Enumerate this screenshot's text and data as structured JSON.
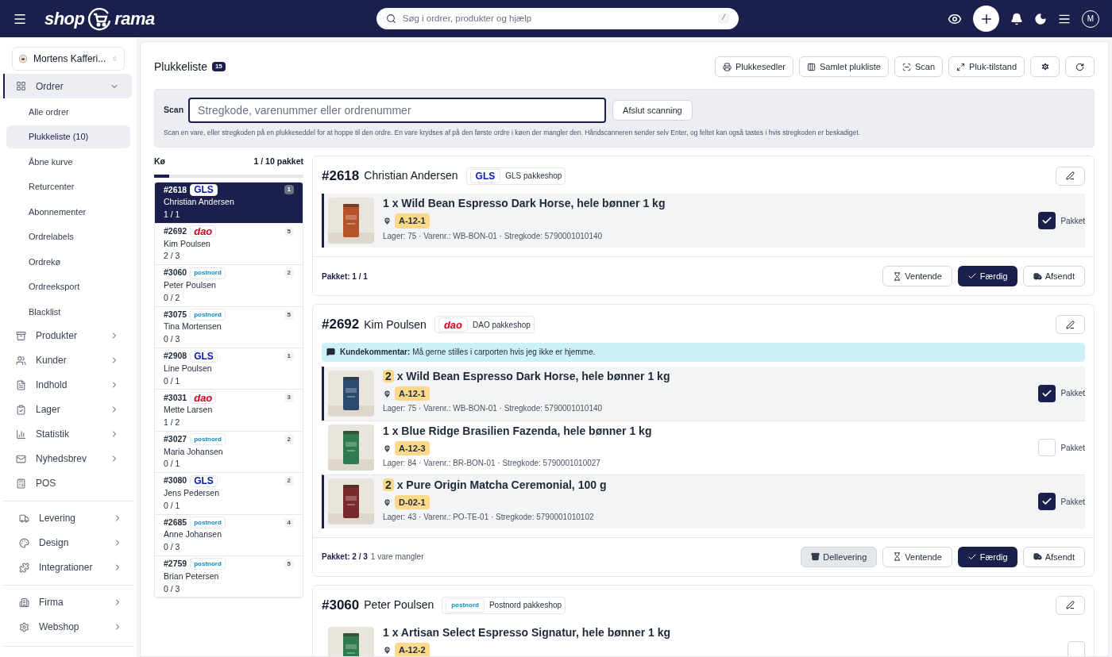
{
  "topbar": {
    "logo_left": "shop",
    "logo_right": "rama",
    "search": {
      "placeholder": "Søg i ordrer, produkter og hjælp",
      "shortcut": "/"
    },
    "avatar": "M"
  },
  "sidebar": {
    "store": "Mortens Kafferi...",
    "sections": [
      [
        {
          "label": "Ordrer",
          "expanded": true,
          "children": [
            {
              "label": "Alle ordrer",
              "selected": false
            },
            {
              "label": "Plukkeliste (10)",
              "selected": true
            },
            {
              "label": "Åbne kurve",
              "selected": false
            },
            {
              "label": "Returcenter",
              "selected": false
            },
            {
              "label": "Abonnementer",
              "selected": false
            },
            {
              "label": "Ordrelabels",
              "selected": false
            },
            {
              "label": "Ordrekø",
              "selected": false
            },
            {
              "label": "Ordreeksport",
              "selected": false
            },
            {
              "label": "Blacklist",
              "selected": false
            }
          ]
        },
        {
          "label": "Produkter",
          "expanded": false
        },
        {
          "label": "Kunder",
          "expanded": false
        },
        {
          "label": "Indhold",
          "expanded": false
        },
        {
          "label": "Lager",
          "expanded": false
        },
        {
          "label": "Statistik",
          "expanded": false
        },
        {
          "label": "Nyhedsbrev",
          "expanded": false
        },
        {
          "label": "POS"
        }
      ],
      [
        {
          "label": "Levering",
          "expanded": false
        },
        {
          "label": "Design",
          "expanded": false
        },
        {
          "label": "Integrationer",
          "expanded": false
        }
      ],
      [
        {
          "label": "Firma",
          "expanded": false
        },
        {
          "label": "Webshop",
          "expanded": false
        }
      ]
    ]
  },
  "page": {
    "title": "Plukkeliste",
    "count": "15",
    "actions": [
      "Plukkesedler",
      "Samlet plukliste",
      "Scan",
      "Pluk-tilstand"
    ]
  },
  "scan": {
    "label": "Scan",
    "placeholder": "Stregkode, varenummer eller ordrenummer",
    "button": "Afslut scanning",
    "help": "Scan en vare, eller stregkoden på en plukkeseddel for at hoppe til den ordre. En vare krydses af på den første ordre i køen der mangler den. Håndscanneren sender selv Enter, og feltet kan også tastes i hvis stregkoden er beskadiget."
  },
  "queue": {
    "title": "Kø",
    "summary": "1 / 10 pakket",
    "level": 0.1,
    "items": [
      {
        "number": "#2618",
        "kind": "gls",
        "logo": "GLS",
        "name": "Christian Andersen",
        "progress": "1 / 1",
        "count": "1",
        "selected": true
      },
      {
        "number": "#2692",
        "kind": "dao",
        "logo": "dao",
        "name": "Kim Poulsen",
        "progress": "2 / 3",
        "count": "5",
        "selected": false
      },
      {
        "number": "#3060",
        "kind": "postnord",
        "logo": "postnord",
        "name": "Peter Poulsen",
        "progress": "0 / 2",
        "count": "2",
        "selected": false
      },
      {
        "number": "#3075",
        "kind": "postnord",
        "logo": "postnord",
        "name": "Tina Mortensen",
        "progress": "0 / 3",
        "count": "5",
        "selected": false
      },
      {
        "number": "#2908",
        "kind": "gls",
        "logo": "GLS",
        "name": "Line Poulsen",
        "progress": "0 / 1",
        "count": "1",
        "selected": false
      },
      {
        "number": "#3031",
        "kind": "dao",
        "logo": "dao",
        "name": "Mette Larsen",
        "progress": "1 / 2",
        "count": "3",
        "selected": false
      },
      {
        "number": "#3027",
        "kind": "postnord",
        "logo": "postnord",
        "name": "Maria Johansen",
        "progress": "0 / 1",
        "count": "2",
        "selected": false
      },
      {
        "number": "#3080",
        "kind": "gls",
        "logo": "GLS",
        "name": "Jens Pedersen",
        "progress": "0 / 1",
        "count": "2",
        "selected": false
      },
      {
        "number": "#2685",
        "kind": "postnord",
        "logo": "postnord",
        "name": "Anne Johansen",
        "progress": "0 / 3",
        "count": "4",
        "selected": false
      },
      {
        "number": "#2759",
        "kind": "postnord",
        "logo": "postnord",
        "name": "Brian Petersen",
        "progress": "0 / 3",
        "count": "5",
        "selected": false
      }
    ]
  },
  "orders": [
    {
      "number": "#2618",
      "name": "Christian Andersen",
      "kind": "gls",
      "logo": "GLS",
      "shipping": "GLS pakkeshop",
      "items": [
        {
          "qty": "1",
          "highlight": false,
          "title": "x Wild Bean Espresso Dark Horse, hele bønner 1 kg",
          "location": "A-12-1",
          "info": "Lager: 75 · Varenr.: WB-BON-01 · Stregkode: 5790001010140",
          "checkbox": "Pakket",
          "packed": true
        }
      ],
      "packed_label": "Pakket: 1 / 1",
      "buttons": [
        {
          "label": "Ventende",
          "kind": "hourglass"
        },
        {
          "label": "Færdig",
          "kind": "done"
        },
        {
          "label": "Afsendt",
          "kind": "shipped"
        }
      ]
    },
    {
      "number": "#2692",
      "name": "Kim Poulsen",
      "kind": "dao",
      "logo": "dao",
      "shipping": "DAO pakkeshop",
      "comment_label": "Kundekommentar:",
      "comment": "Må gerne stilles i carporten hvis jeg ikke er hjemme.",
      "items": [
        {
          "qty": "2",
          "highlight": true,
          "title": "x Wild Bean Espresso Dark Horse, hele bønner 1 kg",
          "location": "A-12-1",
          "info": "Lager: 75 · Varenr.: WB-BON-01 · Stregkode: 5790001010140",
          "checkbox": "Pakket",
          "packed": true
        },
        {
          "qty": "1",
          "highlight": false,
          "title": "x Blue Ridge Brasilien Fazenda, hele bønner 1 kg",
          "location": "A-12-3",
          "info": "Lager: 84 · Varenr.: BR-BON-01 · Stregkode: 5790001010027",
          "checkbox": "Pakket",
          "packed": false
        },
        {
          "qty": "2",
          "highlight": true,
          "title": "x Pure Origin Matcha Ceremonial, 100 g",
          "location": "D-02-1",
          "info": "Lager: 43 · Varenr.: PO-TE-01 · Stregkode: 5790001010102",
          "checkbox": "Pakket",
          "packed": true
        }
      ],
      "packed_label": "Pakket: 2 / 3",
      "missing": "1 vare mangler",
      "buttons": [
        {
          "label": "Dellevering",
          "kind": "partial"
        },
        {
          "label": "Ventende",
          "kind": "hourglass"
        },
        {
          "label": "Færdig",
          "kind": "done"
        },
        {
          "label": "Afsendt",
          "kind": "shipped"
        }
      ]
    },
    {
      "number": "#3060",
      "name": "Peter Poulsen",
      "kind": "postnord",
      "logo": "postnord",
      "shipping": "Postnord pakkeshop",
      "items": [
        {
          "qty": "1",
          "highlight": false,
          "title": "x Artisan Select Espresso Signatur, hele bønner 1 kg",
          "location": "A-12-2",
          "packed": false
        }
      ]
    }
  ]
}
